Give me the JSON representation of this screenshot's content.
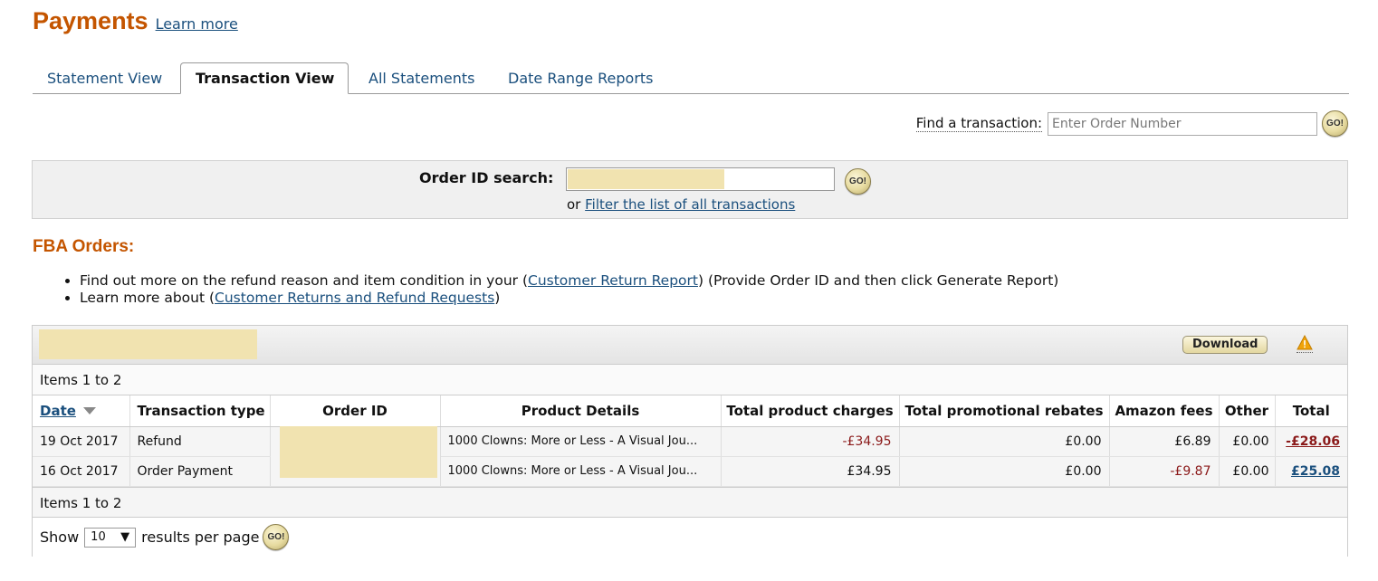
{
  "header": {
    "title": "Payments",
    "learn_more": "Learn more"
  },
  "tabs": [
    {
      "label": "Statement View",
      "active": false
    },
    {
      "label": "Transaction View",
      "active": true
    },
    {
      "label": "All Statements",
      "active": false
    },
    {
      "label": "Date Range Reports",
      "active": false
    }
  ],
  "find": {
    "label": "Find a transaction:",
    "placeholder": "Enter Order Number",
    "go": "GO!"
  },
  "order_search": {
    "label": "Order ID search:",
    "or_text": "or",
    "filter_link": "Filter the list of all transactions",
    "go": "GO!"
  },
  "fba": {
    "title": "FBA Orders:",
    "line1_pre": "Find out more on the refund reason and item condition in your (",
    "line1_link": "Customer Return Report",
    "line1_post": ") (Provide Order ID and then click Generate Report)",
    "line2_pre": "Learn more about (",
    "line2_link": "Customer Returns and Refund Requests",
    "line2_post": ")"
  },
  "results": {
    "download": "Download",
    "items_top": "Items 1 to 2",
    "items_bottom": "Items 1 to 2",
    "columns": {
      "date": "Date",
      "type": "Transaction type",
      "order": "Order ID",
      "product": "Product Details",
      "charges": "Total product charges",
      "promo": "Total promotional rebates",
      "fees": "Amazon fees",
      "other": "Other",
      "total": "Total"
    },
    "rows": [
      {
        "date": "19 Oct 2017",
        "type": "Refund",
        "product": "1000 Clowns: More or Less - A Visual Jou...",
        "charges": "-£34.95",
        "promo": "£0.00",
        "fees": "£6.89",
        "other": "£0.00",
        "total": "-£28.06"
      },
      {
        "date": "16 Oct 2017",
        "type": "Order Payment",
        "product": "1000 Clowns: More or Less - A Visual Jou...",
        "charges": "£34.95",
        "promo": "£0.00",
        "fees": "-£9.87",
        "other": "£0.00",
        "total": "£25.08"
      }
    ]
  },
  "pager": {
    "show": "Show",
    "per_page_value": "10",
    "results_text": "results per page",
    "go": "GO!"
  },
  "colors": {
    "brand_orange": "#c45500",
    "link_blue": "#1a4f7d",
    "negative_red": "#8b1a1a",
    "redaction": "#f1e3b0"
  }
}
